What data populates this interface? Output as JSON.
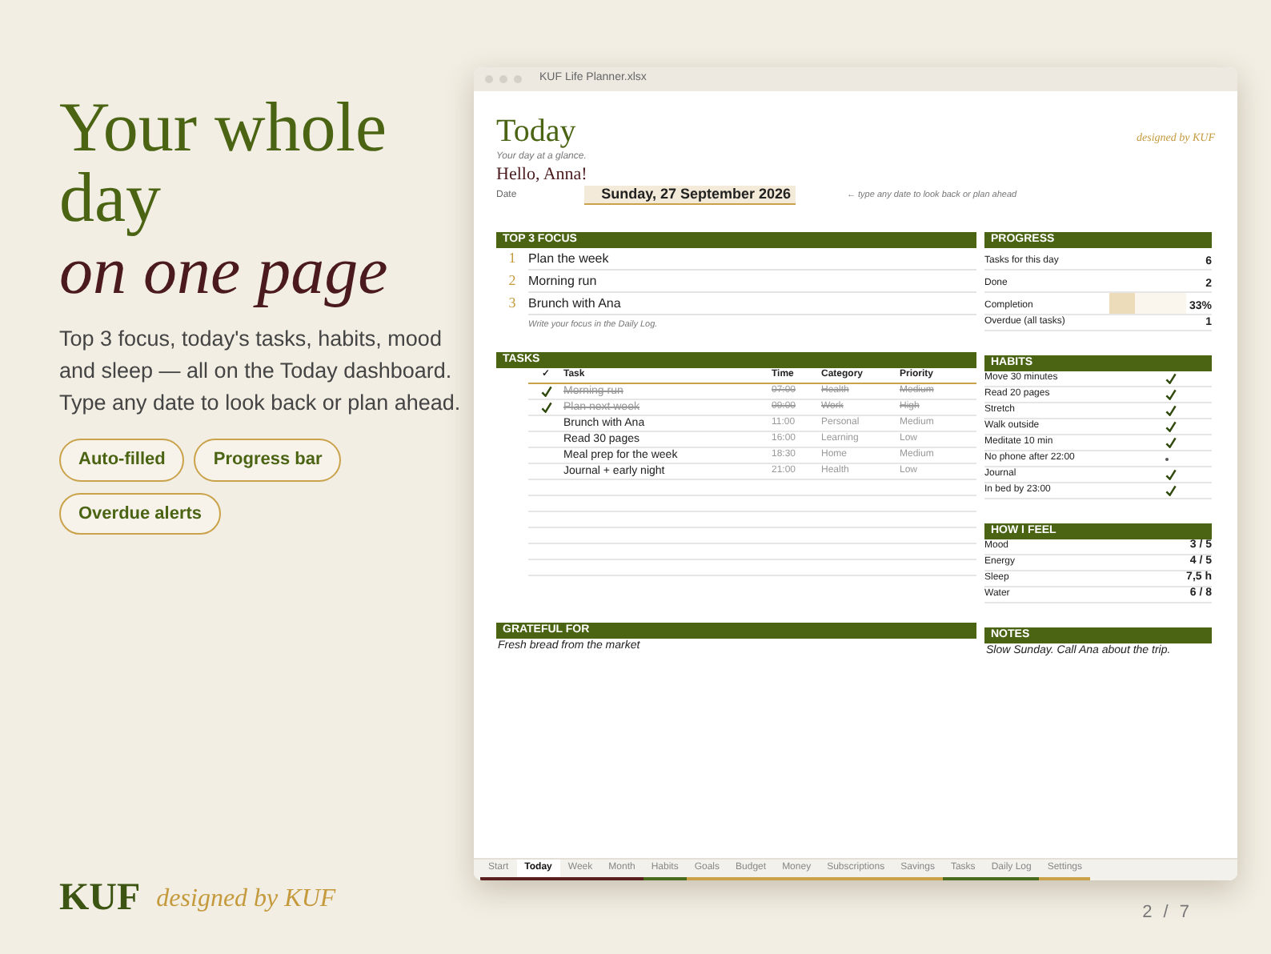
{
  "promo": {
    "headline": "Your whole day",
    "headline_accent": "on one page",
    "description": "Top 3 focus, today's tasks, habits, mood and sleep — all on the Today dashboard. Type any date to look back or plan ahead.",
    "features": [
      "Auto-filled",
      "Progress bar",
      "Overdue alerts"
    ]
  },
  "brand": {
    "logo": "KUF",
    "tagline": "designed by KUF"
  },
  "page_indicator": "2 / 7",
  "window": {
    "title": "KUF Life Planner.xlsx"
  },
  "sheet": {
    "title": "Today",
    "credit": "designed by KUF",
    "subtitle": "Your day at a glance.",
    "greeting": "Hello, Anna!",
    "date_label": "Date",
    "date_value": "Sunday, 27 September 2026",
    "date_hint": "← type any date to look back or plan ahead",
    "focus": {
      "header": "TOP 3 FOCUS",
      "items": [
        {
          "number": "1",
          "text": "Plan the week"
        },
        {
          "number": "2",
          "text": "Morning run"
        },
        {
          "number": "3",
          "text": "Brunch with Ana"
        }
      ],
      "note": "Write your focus in the Daily Log."
    },
    "progress": {
      "header": "PROGRESS",
      "rows": [
        {
          "label": "Tasks for this day",
          "value": "6"
        },
        {
          "label": "Done",
          "value": "2"
        },
        {
          "label": "Completion",
          "value": "33%",
          "level": 0.33
        },
        {
          "label": "Overdue (all tasks)",
          "value": "1"
        }
      ]
    },
    "tasks": {
      "header": "TASKS",
      "columns": [
        "✓",
        "Task",
        "Time",
        "Category",
        "Priority"
      ],
      "rows": [
        {
          "done": true,
          "task": "Morning run",
          "time": "07:00",
          "category": "Health",
          "priority": "Medium"
        },
        {
          "done": true,
          "task": "Plan next week",
          "time": "09:00",
          "category": "Work",
          "priority": "High"
        },
        {
          "done": false,
          "task": "Brunch with Ana",
          "time": "11:00",
          "category": "Personal",
          "priority": "Medium"
        },
        {
          "done": false,
          "task": "Read 30 pages",
          "time": "16:00",
          "category": "Learning",
          "priority": "Low"
        },
        {
          "done": false,
          "task": "Meal prep for the week",
          "time": "18:30",
          "category": "Home",
          "priority": "Medium"
        },
        {
          "done": false,
          "task": "Journal + early night",
          "time": "21:00",
          "category": "Health",
          "priority": "Low"
        }
      ]
    },
    "habits": {
      "header": "HABITS",
      "items": [
        {
          "name": "Move 30 minutes",
          "done": true
        },
        {
          "name": "Read 20 pages",
          "done": true
        },
        {
          "name": "Stretch",
          "done": true
        },
        {
          "name": "Walk outside",
          "done": true
        },
        {
          "name": "Meditate 10 min",
          "done": true
        },
        {
          "name": "No phone after 22:00",
          "done": false
        },
        {
          "name": "Journal",
          "done": true
        },
        {
          "name": "In bed by 23:00",
          "done": true
        }
      ]
    },
    "feelings": {
      "header": "HOW I FEEL",
      "rows": [
        {
          "label": "Mood",
          "value": "3 / 5"
        },
        {
          "label": "Energy",
          "value": "4 / 5"
        },
        {
          "label": "Sleep",
          "value": "7,5 h"
        },
        {
          "label": "Water",
          "value": "6 / 8"
        }
      ]
    },
    "grateful": {
      "header": "GRATEFUL FOR",
      "text": "Fresh bread from the market"
    },
    "notes": {
      "header": "NOTES",
      "text": "Slow Sunday. Call Ana about the trip."
    }
  },
  "sheet_tabs": [
    {
      "label": "Start",
      "selected": false,
      "color": "#5a1f1f"
    },
    {
      "label": "Today",
      "selected": true,
      "color": "#5a1f1f"
    },
    {
      "label": "Week",
      "selected": false,
      "color": "#5a1f1f"
    },
    {
      "label": "Month",
      "selected": false,
      "color": "#5a1f1f"
    },
    {
      "label": "Habits",
      "selected": false,
      "color": "#4a6b1e"
    },
    {
      "label": "Goals",
      "selected": false,
      "color": "#c9a24a"
    },
    {
      "label": "Budget",
      "selected": false,
      "color": "#c9a24a"
    },
    {
      "label": "Money",
      "selected": false,
      "color": "#c9a24a"
    },
    {
      "label": "Subscriptions",
      "selected": false,
      "color": "#c9a24a"
    },
    {
      "label": "Savings",
      "selected": false,
      "color": "#c9a24a"
    },
    {
      "label": "Tasks",
      "selected": false,
      "color": "#4a6b1e"
    },
    {
      "label": "Daily Log",
      "selected": false,
      "color": "#4a6b1e"
    },
    {
      "label": "Settings",
      "selected": false,
      "color": "#c9a24a"
    }
  ]
}
